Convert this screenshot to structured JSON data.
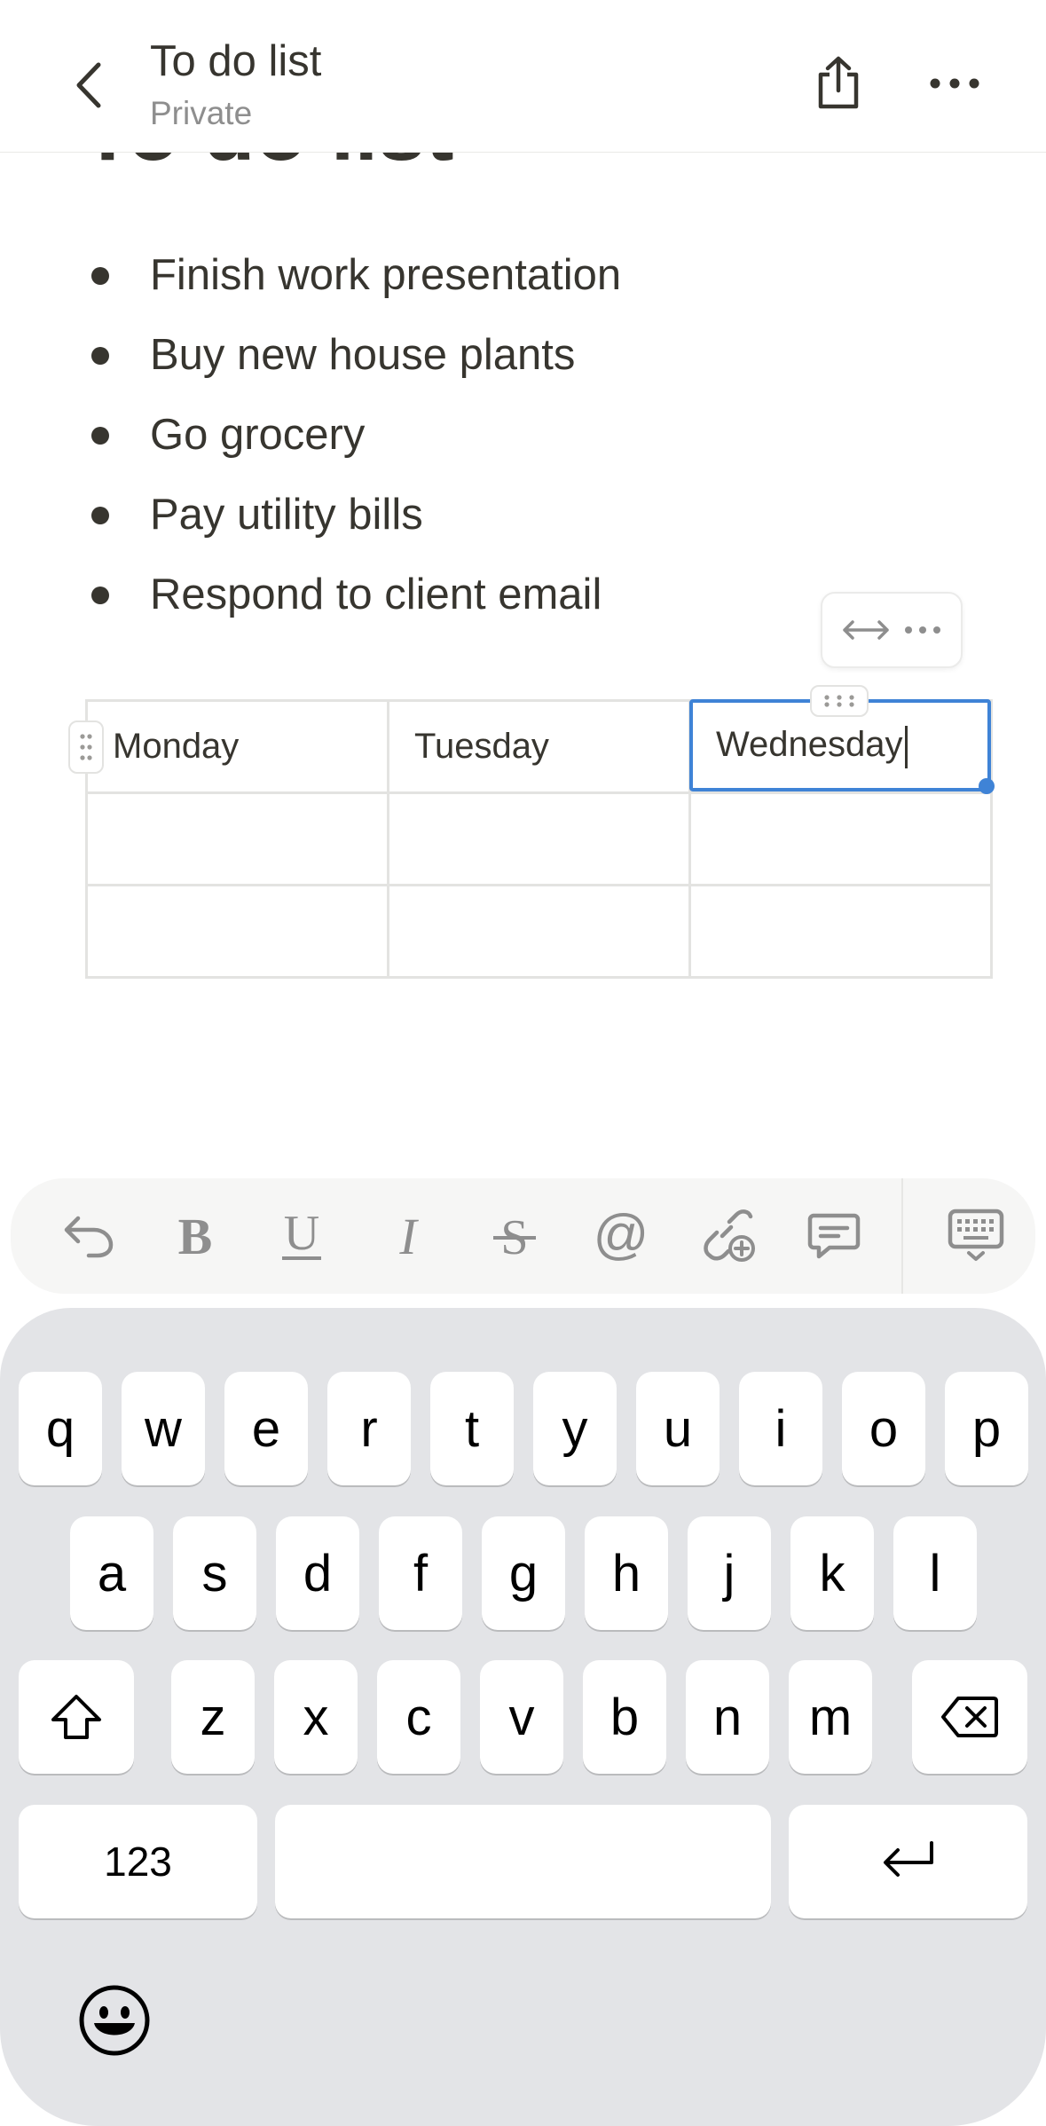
{
  "header": {
    "title": "To do list",
    "subtitle": "Private",
    "back_icon": "chevron-left-icon",
    "share_icon": "share-icon",
    "more_icon": "more-horizontal-icon"
  },
  "page": {
    "title": "To do list",
    "bullets": [
      "Finish work presentation",
      "Buy new house plants",
      "Go grocery",
      "Pay utility bills",
      "Respond to client email"
    ]
  },
  "table": {
    "rows": [
      [
        "Monday",
        "Tuesday",
        "Wednesday"
      ],
      [
        "",
        "",
        ""
      ],
      [
        "",
        "",
        ""
      ]
    ],
    "active_cell": "Wednesday",
    "accent": "#3f83d6"
  },
  "toolbar": {
    "items": [
      "undo-icon",
      "bold-icon",
      "underline-icon",
      "italic-icon",
      "strikethrough-icon",
      "mention-icon",
      "link-add-icon",
      "comment-icon",
      "keyboard-hide-icon"
    ]
  },
  "keyboard": {
    "row1": [
      "q",
      "w",
      "e",
      "r",
      "t",
      "y",
      "u",
      "i",
      "o",
      "p"
    ],
    "row2": [
      "a",
      "s",
      "d",
      "f",
      "g",
      "h",
      "j",
      "k",
      "l"
    ],
    "row3": [
      "z",
      "x",
      "c",
      "v",
      "b",
      "n",
      "m"
    ],
    "numbers_key": "123",
    "space_label": "",
    "shift_icon": "shift-icon",
    "backspace_icon": "backspace-icon",
    "return_icon": "return-icon",
    "emoji_icon": "emoji-icon"
  }
}
